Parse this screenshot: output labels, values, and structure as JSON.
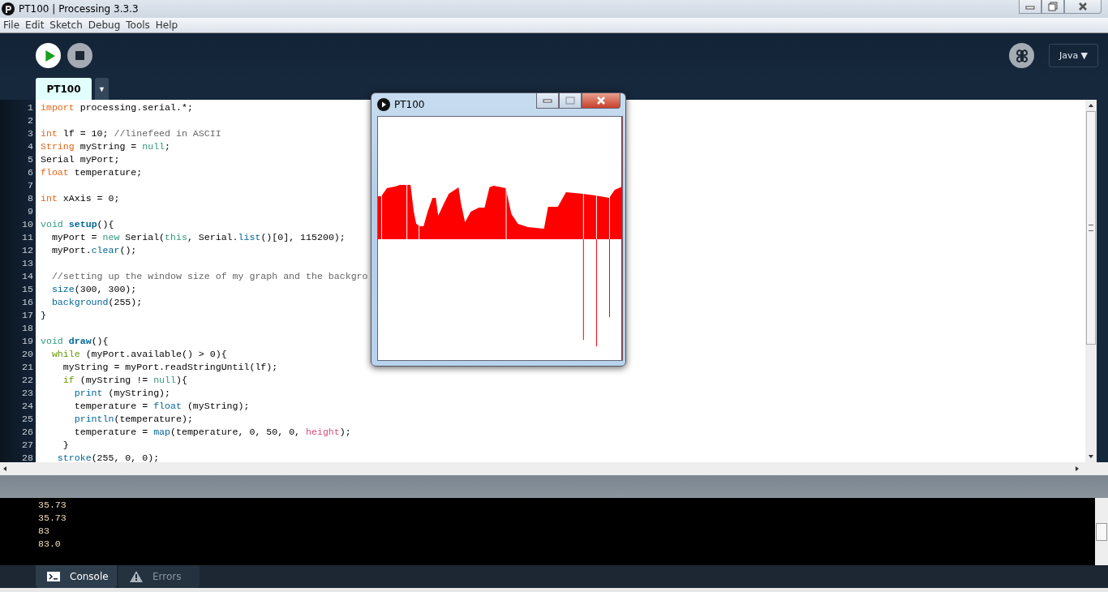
{
  "window": {
    "title": "PT100 | Processing 3.3.3"
  },
  "menu": [
    "File",
    "Edit",
    "Sketch",
    "Debug",
    "Tools",
    "Help"
  ],
  "toolbar": {
    "mode": "Java ▼"
  },
  "tabs": [
    {
      "label": "PT100",
      "selected": true
    }
  ],
  "tab_menu": "▼",
  "editor": {
    "lines": [
      {
        "number": "1",
        "tokens": [
          {
            "text": "import",
            "kind": "keyword"
          },
          {
            "text": " processing.serial.*;",
            "kind": "plain"
          }
        ]
      },
      {
        "number": "2"
      },
      {
        "number": "3",
        "tokens": [
          {
            "text": "int",
            "kind": "keyword"
          },
          {
            "text": " lf = 10; ",
            "kind": "plain"
          },
          {
            "text": "//linefeed in ASCII",
            "kind": "comment"
          }
        ]
      },
      {
        "number": "4",
        "tokens": [
          {
            "text": "String",
            "kind": "keyword"
          },
          {
            "text": " myString = ",
            "kind": "plain"
          },
          {
            "text": "null",
            "kind": "literal"
          },
          {
            "text": ";",
            "kind": "plain"
          }
        ]
      },
      {
        "number": "5",
        "tokens": [
          {
            "text": "Serial myPort;",
            "kind": "plain"
          }
        ]
      },
      {
        "number": "6",
        "tokens": [
          {
            "text": "float",
            "kind": "keyword"
          },
          {
            "text": " temperature;",
            "kind": "plain"
          }
        ]
      },
      {
        "number": "7"
      },
      {
        "number": "8",
        "tokens": [
          {
            "text": "int",
            "kind": "keyword"
          },
          {
            "text": " xAxis = 0;",
            "kind": "plain"
          }
        ]
      },
      {
        "number": "9"
      },
      {
        "number": "10",
        "tokens": [
          {
            "text": "void ",
            "kind": "literal"
          },
          {
            "text": "setup",
            "kind": "definition"
          },
          {
            "text": "(){",
            "kind": "plain"
          }
        ]
      },
      {
        "number": "11",
        "tokens": [
          {
            "text": "  myPort = ",
            "kind": "plain"
          },
          {
            "text": "new",
            "kind": "literal"
          },
          {
            "text": " Serial(",
            "kind": "plain"
          },
          {
            "text": "this",
            "kind": "literal"
          },
          {
            "text": ", Serial.",
            "kind": "plain"
          },
          {
            "text": "list",
            "kind": "function"
          },
          {
            "text": "()[0], 115200);",
            "kind": "plain"
          }
        ]
      },
      {
        "number": "12",
        "tokens": [
          {
            "text": "  myPort.",
            "kind": "plain"
          },
          {
            "text": "clear",
            "kind": "function"
          },
          {
            "text": "();",
            "kind": "plain"
          }
        ]
      },
      {
        "number": "13"
      },
      {
        "number": "14",
        "tokens": [
          {
            "text": "  //setting up the window size of my graph and the backgro",
            "kind": "comment"
          }
        ]
      },
      {
        "number": "15",
        "tokens": [
          {
            "text": "  size",
            "kind": "function"
          },
          {
            "text": "(300, 300);",
            "kind": "plain"
          }
        ]
      },
      {
        "number": "16",
        "tokens": [
          {
            "text": "  background",
            "kind": "function"
          },
          {
            "text": "(255);",
            "kind": "plain"
          }
        ]
      },
      {
        "number": "17",
        "tokens": [
          {
            "text": "}",
            "kind": "plain"
          }
        ]
      },
      {
        "number": "18"
      },
      {
        "number": "19",
        "tokens": [
          {
            "text": "void ",
            "kind": "literal"
          },
          {
            "text": "draw",
            "kind": "definition"
          },
          {
            "text": "(){",
            "kind": "plain"
          }
        ]
      },
      {
        "number": "20",
        "tokens": [
          {
            "text": "  while",
            "kind": "control"
          },
          {
            "text": " (myPort.available() > 0){",
            "kind": "plain"
          }
        ]
      },
      {
        "number": "21",
        "tokens": [
          {
            "text": "    myString = myPort.readStringUntil(lf);",
            "kind": "plain"
          }
        ]
      },
      {
        "number": "22",
        "tokens": [
          {
            "text": "    if",
            "kind": "control"
          },
          {
            "text": " (myString != ",
            "kind": "plain"
          },
          {
            "text": "null",
            "kind": "literal"
          },
          {
            "text": "){",
            "kind": "plain"
          }
        ]
      },
      {
        "number": "23",
        "tokens": [
          {
            "text": "      print",
            "kind": "function"
          },
          {
            "text": " (myString);",
            "kind": "plain"
          }
        ]
      },
      {
        "number": "24",
        "tokens": [
          {
            "text": "      temperature = ",
            "kind": "plain"
          },
          {
            "text": "float",
            "kind": "function"
          },
          {
            "text": " (myString);",
            "kind": "plain"
          }
        ]
      },
      {
        "number": "25",
        "tokens": [
          {
            "text": "      println",
            "kind": "function"
          },
          {
            "text": "(temperature);",
            "kind": "plain"
          }
        ]
      },
      {
        "number": "26",
        "tokens": [
          {
            "text": "      temperature = ",
            "kind": "plain"
          },
          {
            "text": "map",
            "kind": "function"
          },
          {
            "text": "(temperature, 0, 50, 0, ",
            "kind": "plain"
          },
          {
            "text": "height",
            "kind": "constant"
          },
          {
            "text": ");",
            "kind": "plain"
          }
        ]
      },
      {
        "number": "27",
        "tokens": [
          {
            "text": "    }",
            "kind": "plain"
          }
        ]
      },
      {
        "number": "28",
        "tokens": [
          {
            "text": "   stroke",
            "kind": "function"
          },
          {
            "text": "(255, 0, 0);",
            "kind": "plain"
          }
        ]
      }
    ]
  },
  "sketch_window": {
    "title": "PT100"
  },
  "console": {
    "lines": [
      "35.73",
      "35.73",
      "83",
      "83.0"
    ]
  },
  "console_tabs": [
    {
      "label": "Console",
      "selected": true,
      "kind": "console"
    },
    {
      "label": "Errors",
      "selected": false,
      "kind": "errors"
    }
  ]
}
